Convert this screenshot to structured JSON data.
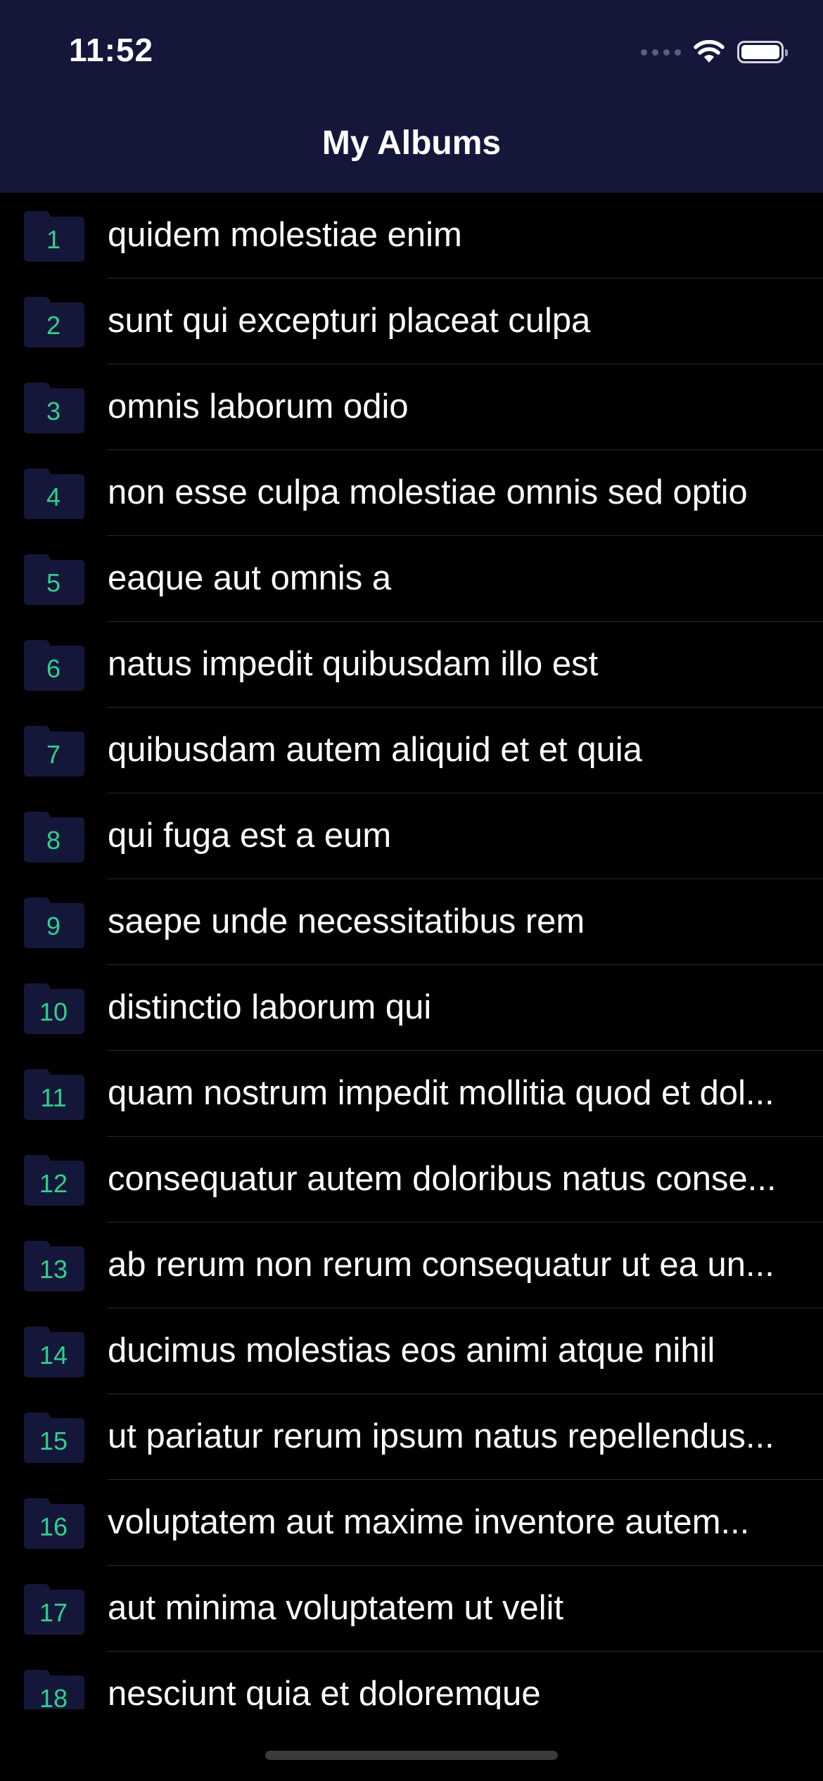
{
  "status_bar": {
    "time": "11:52"
  },
  "nav": {
    "title": "My Albums"
  },
  "colors": {
    "header_bg": "#15173a",
    "list_bg": "#000000",
    "folder": "#15173a",
    "number": "#2fd08b",
    "text": "#ffffff"
  },
  "albums": [
    {
      "id": "1",
      "title": "quidem molestiae enim"
    },
    {
      "id": "2",
      "title": "sunt qui excepturi placeat culpa"
    },
    {
      "id": "3",
      "title": "omnis laborum odio"
    },
    {
      "id": "4",
      "title": "non esse culpa molestiae omnis sed optio"
    },
    {
      "id": "5",
      "title": "eaque aut omnis a"
    },
    {
      "id": "6",
      "title": "natus impedit quibusdam illo est"
    },
    {
      "id": "7",
      "title": "quibusdam autem aliquid et et quia"
    },
    {
      "id": "8",
      "title": "qui fuga est a eum"
    },
    {
      "id": "9",
      "title": "saepe unde necessitatibus rem"
    },
    {
      "id": "10",
      "title": "distinctio laborum qui"
    },
    {
      "id": "11",
      "title": "quam nostrum impedit mollitia quod et dol..."
    },
    {
      "id": "12",
      "title": "consequatur autem doloribus natus conse..."
    },
    {
      "id": "13",
      "title": "ab rerum non rerum consequatur ut ea un..."
    },
    {
      "id": "14",
      "title": "ducimus molestias eos animi atque nihil"
    },
    {
      "id": "15",
      "title": "ut pariatur rerum ipsum natus repellendus..."
    },
    {
      "id": "16",
      "title": "voluptatem aut maxime inventore autem..."
    },
    {
      "id": "17",
      "title": "aut minima voluptatem ut velit"
    },
    {
      "id": "18",
      "title": "nesciunt quia et doloremque"
    }
  ]
}
